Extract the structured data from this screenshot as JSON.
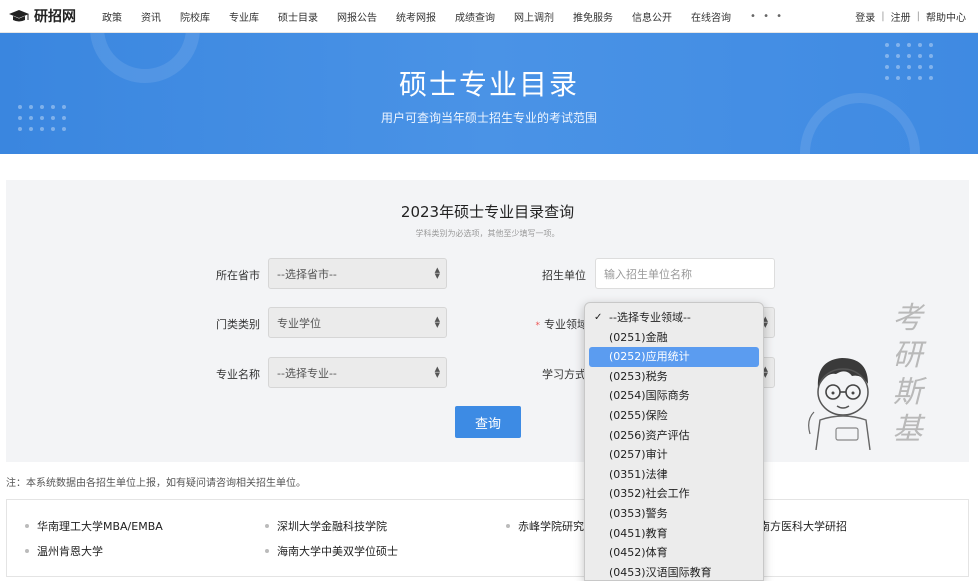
{
  "site": {
    "name": "研招网"
  },
  "nav": {
    "items": [
      "政策",
      "资讯",
      "院校库",
      "专业库",
      "硕士目录",
      "网报公告",
      "统考网报",
      "成绩查询",
      "网上调剂",
      "推免服务",
      "信息公开",
      "在线咨询"
    ],
    "more": "• • •",
    "login": "登录",
    "register": "注册",
    "help": "帮助中心"
  },
  "banner": {
    "title": "硕士专业目录",
    "subtitle": "用户可查询当年硕士招生专业的考试范围"
  },
  "panel": {
    "title": "2023年硕士专业目录查询",
    "hint": "学科类别为必选项，其他至少填写一项。",
    "province_label": "所在省市",
    "province_value": "--选择省市--",
    "unit_label": "招生单位",
    "unit_placeholder": "输入招生单位名称",
    "category_label": "门类类别",
    "category_value": "专业学位",
    "field_label": "专业领域",
    "field_required": "*",
    "major_label": "专业名称",
    "major_value": "--选择专业--",
    "study_label": "学习方式",
    "query_button": "查询"
  },
  "watermark": {
    "text": "考研斯基"
  },
  "note": "注：本系统数据由各招生单位上报，如有疑问请咨询相关招生单位。",
  "links": {
    "row1": [
      "华南理工大学MBA/EMBA",
      "深圳大学金融科技学院",
      "赤峰学院研究",
      "南方医科大学研招"
    ],
    "row2": [
      "温州肯恩大学",
      "海南大学中美双学位硕士"
    ]
  },
  "dropdown": {
    "check": "✓",
    "selected_index": 2,
    "options": [
      "--选择专业领域--",
      "(0251)金融",
      "(0252)应用统计",
      "(0253)税务",
      "(0254)国际商务",
      "(0255)保险",
      "(0256)资产评估",
      "(0257)审计",
      "(0351)法律",
      "(0352)社会工作",
      "(0353)警务",
      "(0451)教育",
      "(0452)体育",
      "(0453)汉语国际教育"
    ]
  },
  "colors": {
    "primary": "#3d8be4",
    "banner": "#4a93e6",
    "highlight": "#5b9cf0",
    "required": "#e55555"
  }
}
